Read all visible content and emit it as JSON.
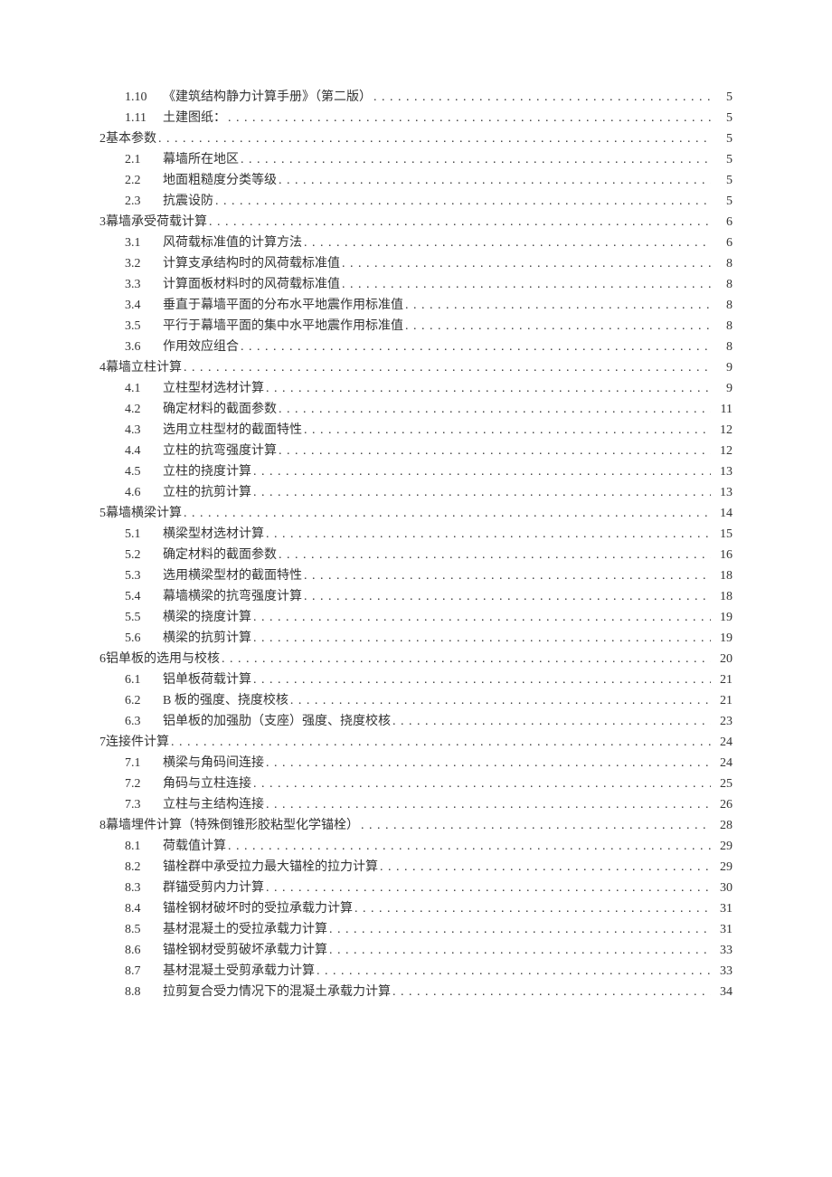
{
  "toc": [
    {
      "level": 2,
      "num": "1.10",
      "title": "《建筑结构静力计算手册》（第二版）",
      "page": "5"
    },
    {
      "level": 2,
      "num": "1.11",
      "title": "土建图纸：",
      "page": "5"
    },
    {
      "level": 1,
      "num": "2",
      "title": "基本参数",
      "page": "5"
    },
    {
      "level": 2,
      "num": "2.1",
      "title": "幕墙所在地区",
      "page": "5"
    },
    {
      "level": 2,
      "num": "2.2",
      "title": "地面粗糙度分类等级",
      "page": "5"
    },
    {
      "level": 2,
      "num": "2.3",
      "title": "抗震设防",
      "page": "5"
    },
    {
      "level": 1,
      "num": "3",
      "title": "幕墙承受荷载计算",
      "page": "6"
    },
    {
      "level": 2,
      "num": "3.1",
      "title": "风荷载标准值的计算方法",
      "page": "6"
    },
    {
      "level": 2,
      "num": "3.2",
      "title": "计算支承结构时的风荷载标准值",
      "page": "8"
    },
    {
      "level": 2,
      "num": "3.3",
      "title": "计算面板材料时的风荷载标准值",
      "page": "8"
    },
    {
      "level": 2,
      "num": "3.4",
      "title": "垂直于幕墙平面的分布水平地震作用标准值",
      "page": "8"
    },
    {
      "level": 2,
      "num": "3.5",
      "title": "平行于幕墙平面的集中水平地震作用标准值",
      "page": "8"
    },
    {
      "level": 2,
      "num": "3.6",
      "title": "作用效应组合",
      "page": "8"
    },
    {
      "level": 1,
      "num": "4",
      "title": "幕墙立柱计算",
      "page": "9"
    },
    {
      "level": 2,
      "num": "4.1",
      "title": "立柱型材选材计算",
      "page": "9"
    },
    {
      "level": 2,
      "num": "4.2",
      "title": "确定材料的截面参数",
      "page": "11"
    },
    {
      "level": 2,
      "num": "4.3",
      "title": "选用立柱型材的截面特性",
      "page": "12"
    },
    {
      "level": 2,
      "num": "4.4",
      "title": "立柱的抗弯强度计算",
      "page": "12"
    },
    {
      "level": 2,
      "num": "4.5",
      "title": "立柱的挠度计算",
      "page": "13"
    },
    {
      "level": 2,
      "num": "4.6",
      "title": "立柱的抗剪计算",
      "page": "13"
    },
    {
      "level": 1,
      "num": "5",
      "title": "幕墙横梁计算",
      "page": "14"
    },
    {
      "level": 2,
      "num": "5.1",
      "title": "横梁型材选材计算",
      "page": "15"
    },
    {
      "level": 2,
      "num": "5.2",
      "title": "确定材料的截面参数",
      "page": "16"
    },
    {
      "level": 2,
      "num": "5.3",
      "title": "选用横梁型材的截面特性",
      "page": "18"
    },
    {
      "level": 2,
      "num": "5.4",
      "title": "幕墙横梁的抗弯强度计算",
      "page": "18"
    },
    {
      "level": 2,
      "num": "5.5",
      "title": "横梁的挠度计算",
      "page": "19"
    },
    {
      "level": 2,
      "num": "5.6",
      "title": "横梁的抗剪计算",
      "page": "19"
    },
    {
      "level": 1,
      "num": "6",
      "title": "铝单板的选用与校核",
      "page": "20"
    },
    {
      "level": 2,
      "num": "6.1",
      "title": "铝单板荷载计算",
      "page": "21"
    },
    {
      "level": 2,
      "num": "6.2",
      "title": "B 板的强度、挠度校核",
      "page": "21"
    },
    {
      "level": 2,
      "num": "6.3",
      "title": "铝单板的加强肋（支座）强度、挠度校核",
      "page": "23"
    },
    {
      "level": 1,
      "num": "7",
      "title": "连接件计算",
      "page": "24"
    },
    {
      "level": 2,
      "num": "7.1",
      "title": "横梁与角码间连接",
      "page": "24"
    },
    {
      "level": 2,
      "num": "7.2",
      "title": "角码与立柱连接",
      "page": "25"
    },
    {
      "level": 2,
      "num": "7.3",
      "title": "立柱与主结构连接",
      "page": "26"
    },
    {
      "level": 1,
      "num": "8",
      "title": "幕墙埋件计算（特殊倒锥形胶粘型化学锚栓）",
      "page": "28"
    },
    {
      "level": 2,
      "num": "8.1",
      "title": "荷载值计算",
      "page": "29"
    },
    {
      "level": 2,
      "num": "8.2",
      "title": "锚栓群中承受拉力最大锚栓的拉力计算",
      "page": "29"
    },
    {
      "level": 2,
      "num": "8.3",
      "title": "群锚受剪内力计算",
      "page": "30"
    },
    {
      "level": 2,
      "num": "8.4",
      "title": "锚栓钢材破坏时的受拉承载力计算",
      "page": "31"
    },
    {
      "level": 2,
      "num": "8.5",
      "title": "基材混凝土的受拉承载力计算",
      "page": "31"
    },
    {
      "level": 2,
      "num": "8.6",
      "title": "锚栓钢材受剪破坏承载力计算",
      "page": "33"
    },
    {
      "level": 2,
      "num": "8.7",
      "title": "基材混凝土受剪承载力计算",
      "page": "33"
    },
    {
      "level": 2,
      "num": "8.8",
      "title": "拉剪复合受力情况下的混凝土承载力计算",
      "page": "34"
    }
  ]
}
